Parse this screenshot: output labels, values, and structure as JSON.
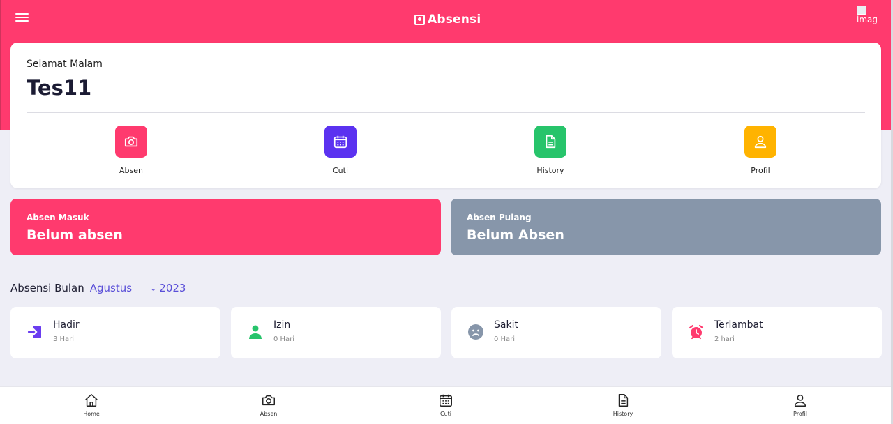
{
  "header": {
    "brand": "Absensi",
    "avatar_alt": "imag"
  },
  "greeting": {
    "label": "Selamat Malam",
    "name": "Tes11"
  },
  "quick_actions": [
    {
      "label": "Absen",
      "icon": "camera-icon",
      "color": "#ff3a6e"
    },
    {
      "label": "Cuti",
      "icon": "calendar-icon",
      "color": "#5b32f0"
    },
    {
      "label": "History",
      "icon": "document-icon",
      "color": "#27c46b"
    },
    {
      "label": "Profil",
      "icon": "user-icon",
      "color": "#ffb300"
    }
  ],
  "status": {
    "masuk": {
      "label": "Absen Masuk",
      "value": "Belum absen",
      "color": "#ff3a6e"
    },
    "pulang": {
      "label": "Absen Pulang",
      "value": "Belum Absen",
      "color": "#8796aa"
    }
  },
  "month": {
    "prefix": "Absensi Bulan",
    "month": "Agustus",
    "year": "2023"
  },
  "stats": [
    {
      "title": "Hadir",
      "value": "3 Hari",
      "icon": "login-icon",
      "color": "#6a3df0"
    },
    {
      "title": "Izin",
      "value": "0 Hari",
      "icon": "person-icon",
      "color": "#27c46b"
    },
    {
      "title": "Sakit",
      "value": "0 Hari",
      "icon": "sad-face-icon",
      "color": "#8796aa"
    },
    {
      "title": "Terlambat",
      "value": "2 hari",
      "icon": "alarm-icon",
      "color": "#ff3a6e"
    }
  ],
  "nav": [
    {
      "label": "Home",
      "icon": "home-icon"
    },
    {
      "label": "Absen",
      "icon": "camera-icon"
    },
    {
      "label": "Cuti",
      "icon": "calendar-icon"
    },
    {
      "label": "History",
      "icon": "document-icon"
    },
    {
      "label": "Profil",
      "icon": "user-icon"
    }
  ]
}
